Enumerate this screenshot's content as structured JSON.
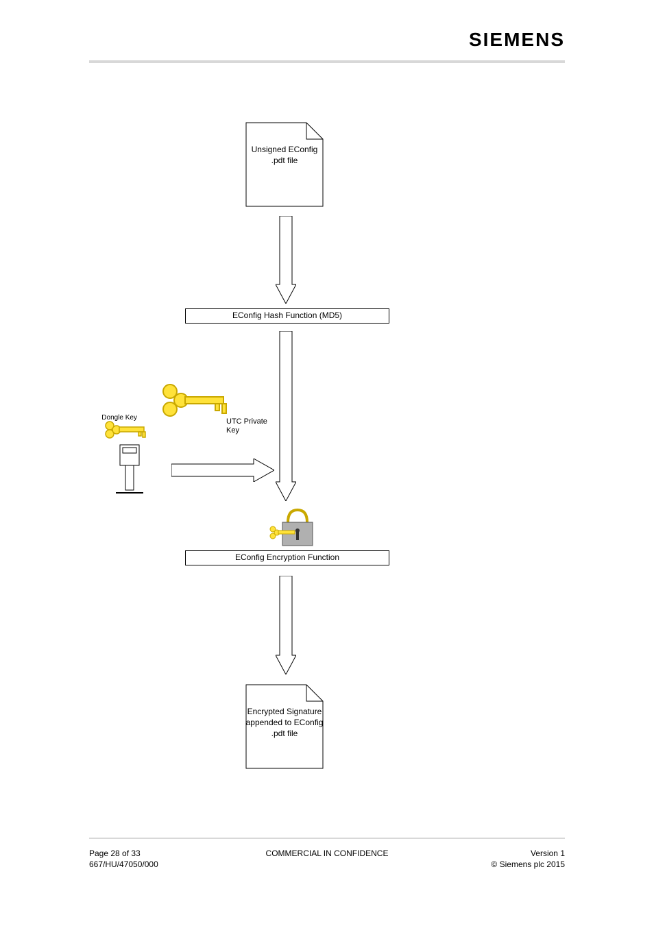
{
  "header": {
    "brand": "SIEMENS"
  },
  "diagram": {
    "unsigned_label": "Unsigned EConfig .pdt file",
    "step1": "EConfig Hash Function (MD5)",
    "step2": "EConfig Encryption Function",
    "signed_label": "Encrypted Signature appended to EConfig .pdt file",
    "big_key_label": "UTC Private Key",
    "small_key_label": "Dongle Key"
  },
  "footer": {
    "page": "Page 28 of 33",
    "confidentiality": "COMMERCIAL IN CONFIDENCE",
    "version": "Version 1",
    "doc_id": "667/HU/47050/000",
    "copyright": "© Siemens plc 2015"
  }
}
